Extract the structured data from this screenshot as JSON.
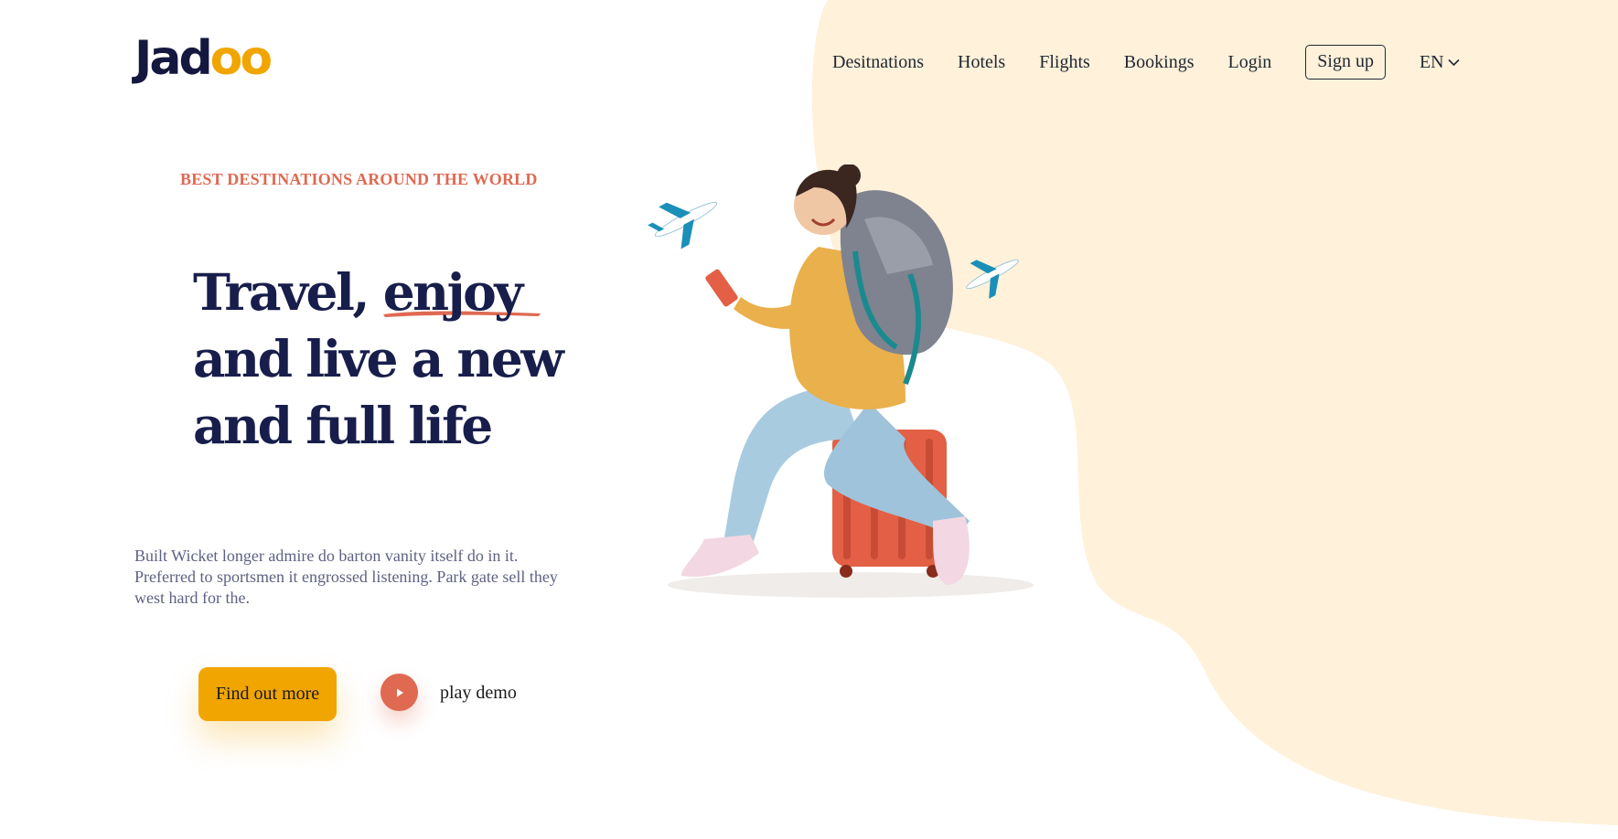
{
  "brand": {
    "logo_prefix": "Jad",
    "logo_suffix": "oo"
  },
  "nav": {
    "items": [
      {
        "label": "Desitnations"
      },
      {
        "label": "Hotels"
      },
      {
        "label": "Flights"
      },
      {
        "label": "Bookings"
      },
      {
        "label": "Login"
      }
    ],
    "signup_label": "Sign up",
    "language": "EN",
    "language_icon": "chevron-down-icon"
  },
  "hero": {
    "tagline": "BEST DESTINATIONS AROUND THE WORLD",
    "headline_line1_prefix": "Travel, ",
    "headline_line1_highlight": "enjoy",
    "headline_line2": "and live a new",
    "headline_line3": "and full life",
    "description": "Built Wicket longer admire do barton vanity itself do in it. Preferred to sportsmen it engrossed listening. Park gate sell they west hard for the.",
    "cta_label": "Find out more",
    "play_label": "play demo",
    "play_icon": "play-icon",
    "image_alt": "traveler-with-suitcase"
  },
  "colors": {
    "primary": "#f1a501",
    "accent": "#df6951",
    "heading": "#181e4b",
    "body_text": "#5e6282",
    "background_blob": "#fff1da"
  }
}
